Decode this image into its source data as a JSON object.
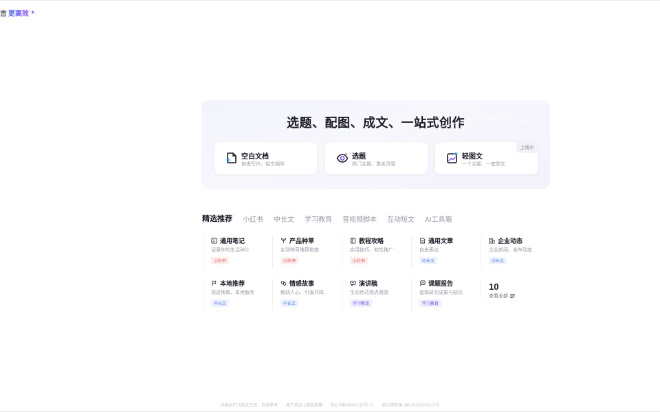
{
  "brand": {
    "prefix": "吉",
    "tagline": "更高效",
    "spark": "✦"
  },
  "hero": {
    "title": "选题、配图、成文、一站式创作",
    "cards": [
      {
        "title": "空白文档",
        "subtitle": "自由写作、轻文相伴",
        "icon": "blank-doc-icon"
      },
      {
        "title": "选题",
        "subtitle": "热门主题、激发灵感",
        "icon": "eye-icon"
      },
      {
        "title": "轻图文",
        "subtitle": "一个主题、一套图文",
        "icon": "image-text-icon",
        "badge": "上线中"
      }
    ]
  },
  "tabs": [
    "精选推荐",
    "小红书",
    "中长文",
    "学习教育",
    "音视频脚本",
    "互动短文",
    "AI工具箱"
  ],
  "templates": [
    {
      "name": "通用笔记",
      "desc": "记录你的生活碎片",
      "tag": "小红书",
      "tag_color": "red",
      "icon": "note-icon"
    },
    {
      "name": "产品种草",
      "desc": "实测种草推荐指南",
      "tag": "小红书",
      "tag_color": "red",
      "icon": "heart-plant-icon"
    },
    {
      "name": "教程攻略",
      "desc": "实用技巧、软性推广",
      "tag": "小红书",
      "tag_color": "red",
      "icon": "book-icon"
    },
    {
      "name": "通用文章",
      "desc": "自由表达",
      "tag": "中长文",
      "tag_color": "blue",
      "icon": "article-icon"
    },
    {
      "name": "企业动态",
      "desc": "企业新闻、发布动态",
      "tag": "中长文",
      "tag_color": "blue",
      "icon": "building-icon"
    },
    {
      "name": "本地推荐",
      "desc": "探店推荐、本地服务",
      "tag": "中长文",
      "tag_color": "blue",
      "icon": "flag-icon"
    },
    {
      "name": "情感故事",
      "desc": "触动人心、引发共鸣",
      "tag": "中长文",
      "tag_color": "blue",
      "icon": "emotion-icon"
    },
    {
      "name": "演讲稿",
      "desc": "生动传达观点情感",
      "tag": "学习教育",
      "tag_color": "purple",
      "icon": "speech-icon"
    },
    {
      "name": "课题报告",
      "desc": "呈现研究成果与结论",
      "tag": "学习教育",
      "tag_color": "purple",
      "icon": "report-icon"
    }
  ],
  "more": {
    "count": "10",
    "label": "查看全部",
    "icon": "list-icon"
  },
  "footer": [
    "内容由讯飞轻文生成，仅供参考",
    "用户协议 | 隐私政策",
    "皖ICP备05001217号-71",
    "皖公网安备 34019202000117号"
  ],
  "colors": {
    "accent_blue": "#3c6cf5",
    "accent_purple": "#9b4dff",
    "tag_red": "#e0504f",
    "tag_blue": "#4b7be6",
    "tag_purple": "#6e5be0"
  }
}
